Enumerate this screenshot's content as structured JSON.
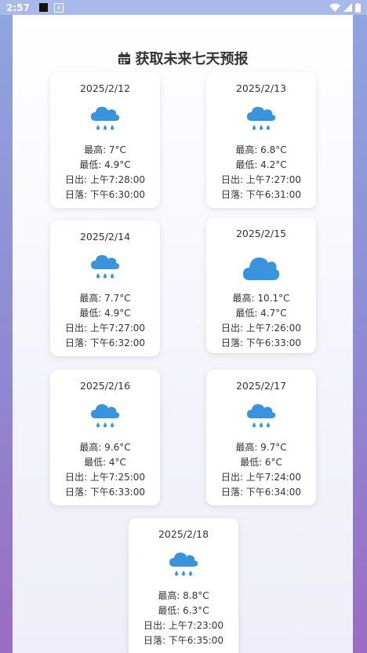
{
  "status_bar": {
    "time": "2:57"
  },
  "page": {
    "title": "获取未来七天预报"
  },
  "forecast": [
    {
      "date": "2025/2/12",
      "high": "最高: 7°C",
      "low": "最低: 4.9°C",
      "sunrise": "日出: 上午7:28:00",
      "sunset": "日落: 下午6:30:00",
      "icon": "rain-cloud-icon"
    },
    {
      "date": "2025/2/13",
      "high": "最高: 6.8°C",
      "low": "最低: 4.2°C",
      "sunrise": "日出: 上午7:27:00",
      "sunset": "日落: 下午6:31:00",
      "icon": "rain-cloud-icon"
    },
    {
      "date": "2025/2/14",
      "high": "最高: 7.7°C",
      "low": "最低: 4.9°C",
      "sunrise": "日出: 上午7:27:00",
      "sunset": "日落: 下午6:32:00",
      "icon": "rain-cloud-icon"
    },
    {
      "date": "2025/2/15",
      "high": "最高: 10.1°C",
      "low": "最低: 4.7°C",
      "sunrise": "日出: 上午7:26:00",
      "sunset": "日落: 下午6:33:00",
      "icon": "cloud-icon"
    },
    {
      "date": "2025/2/16",
      "high": "最高: 9.6°C",
      "low": "最低: 4°C",
      "sunrise": "日出: 上午7:25:00",
      "sunset": "日落: 下午6:33:00",
      "icon": "rain-cloud-icon"
    },
    {
      "date": "2025/2/17",
      "high": "最高: 9.7°C",
      "low": "最低: 6°C",
      "sunrise": "日出: 上午7:24:00",
      "sunset": "日落: 下午6:34:00",
      "icon": "rain-cloud-icon"
    },
    {
      "date": "2025/2/18",
      "high": "最高: 8.8°C",
      "low": "最低: 6.3°C",
      "sunrise": "日出: 上午7:23:00",
      "sunset": "日落: 下午6:35:00",
      "icon": "rain-cloud-icon"
    }
  ],
  "colors": {
    "accent": "#3a94dd"
  }
}
